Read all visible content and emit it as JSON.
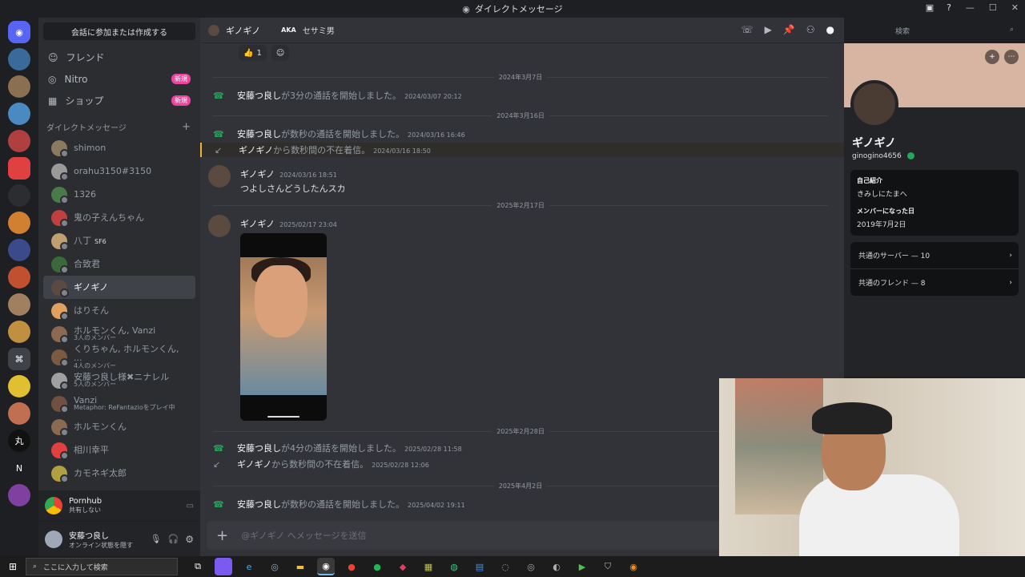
{
  "window": {
    "title": "ダイレクトメッセージ"
  },
  "sidebar": {
    "find_label": "会話に参加または作成する",
    "nav": [
      {
        "label": "フレンド",
        "icon": "friends-icon",
        "badge": ""
      },
      {
        "label": "Nitro",
        "icon": "nitro-icon",
        "badge": "新規"
      },
      {
        "label": "ショップ",
        "icon": "shop-icon",
        "badge": "新規"
      }
    ],
    "dm_header": "ダイレクトメッセージ",
    "dm_add": "+",
    "dms": [
      {
        "name": "shimon",
        "sub": "",
        "tag": "",
        "color": "#8a7a60"
      },
      {
        "name": "orahu3150#3150",
        "sub": "",
        "tag": "",
        "color": "#9a9a9a"
      },
      {
        "name": "1326",
        "sub": "",
        "tag": "",
        "color": "#4a7a4a"
      },
      {
        "name": "鬼の子えんちゃん",
        "sub": "",
        "tag": "",
        "color": "#c04040"
      },
      {
        "name": "八丁",
        "sub": "",
        "tag": "SF6",
        "color": "#c0a070"
      },
      {
        "name": "合致君",
        "sub": "",
        "tag": "",
        "color": "#3a6a3a"
      },
      {
        "name": "ギノギノ",
        "sub": "",
        "tag": "",
        "color": "#5a4a40"
      },
      {
        "name": "はりそん",
        "sub": "",
        "tag": "",
        "color": "#e0a060"
      },
      {
        "name": "ホルモンくん, Vanzi",
        "sub": "3人のメンバー",
        "tag": "",
        "color": "#8a6a50"
      },
      {
        "name": "くりちゃん, ホルモンくん, ...",
        "sub": "4人のメンバー",
        "tag": "",
        "color": "#7a5a40"
      },
      {
        "name": "安藤つ良し様✖ニナレル",
        "sub": "5人のメンバー",
        "tag": "",
        "color": "#a0a0a0"
      },
      {
        "name": "Vanzi",
        "sub": "Metaphor: ReFantazioをプレイ中",
        "tag": "",
        "color": "#705040"
      },
      {
        "name": "ホルモンくん",
        "sub": "",
        "tag": "",
        "color": "#8a6a50"
      },
      {
        "name": "相川幸平",
        "sub": "",
        "tag": "",
        "color": "#e04040"
      },
      {
        "name": "カモネギ太郎",
        "sub": "",
        "tag": "",
        "color": "#b0a040"
      }
    ],
    "activity": {
      "title": "Pornhub",
      "sub": "共有しない"
    },
    "user": {
      "name": "安藤つ良し",
      "status": "オンライン状態を隠す"
    }
  },
  "header": {
    "name": "ギノギノ",
    "aka": "AKA",
    "nickname": "セサミ男",
    "search_placeholder": "検索"
  },
  "messages": {
    "reaction": {
      "emoji": "👍",
      "count": "1"
    },
    "items": [
      {
        "kind": "divider",
        "text": "2024年3月7日"
      },
      {
        "kind": "call",
        "user": "安藤つ良し",
        "text": "が3分の通話を開始しました。",
        "ts": "2024/03/07 20:12"
      },
      {
        "kind": "divider",
        "text": "2024年3月16日"
      },
      {
        "kind": "call",
        "user": "安藤つ良し",
        "text": "が数秒の通話を開始しました。",
        "ts": "2024/03/16 16:46"
      },
      {
        "kind": "missed",
        "user": "ギノギノ",
        "text": "から数秒間の不在着信。",
        "ts": "2024/03/16 18:50"
      },
      {
        "kind": "msg",
        "user": "ギノギノ",
        "ts": "2024/03/16 18:51",
        "text": "つよしさんどうしたんスカ"
      },
      {
        "kind": "divider",
        "text": "2025年2月17日"
      },
      {
        "kind": "msg",
        "user": "ギノギノ",
        "ts": "2025/02/17 23:04",
        "text": ""
      },
      {
        "kind": "divider",
        "text": "2025年2月28日"
      },
      {
        "kind": "call",
        "user": "安藤つ良し",
        "text": "が4分の通話を開始しました。",
        "ts": "2025/02/28 11:58"
      },
      {
        "kind": "missed",
        "user": "ギノギノ",
        "text": "から数秒間の不在着信。",
        "ts": "2025/02/28 12:06"
      },
      {
        "kind": "divider",
        "text": "2025年4月2日"
      },
      {
        "kind": "call",
        "user": "安藤つ良し",
        "text": "が数秒の通話を開始しました。",
        "ts": "2025/04/02 19:11"
      }
    ],
    "composer_placeholder": "@ギノギノ へメッセージを送信"
  },
  "profile": {
    "name": "ギノギノ",
    "username": "ginogino4656",
    "bio_heading": "自己紹介",
    "bio": "きみしにたまへ",
    "member_heading": "メンバーになった日",
    "member_since": "2019年7月2日",
    "mutual_servers": "共通のサーバー — 10",
    "mutual_friends": "共通のフレンド — 8"
  },
  "taskbar": {
    "search_placeholder": "ここに入力して検索"
  },
  "colors": {
    "accent": "#5865f2",
    "call_green": "#23a55a",
    "badge_pink": "#eb459e",
    "missed_highlight": "#f0b232"
  }
}
